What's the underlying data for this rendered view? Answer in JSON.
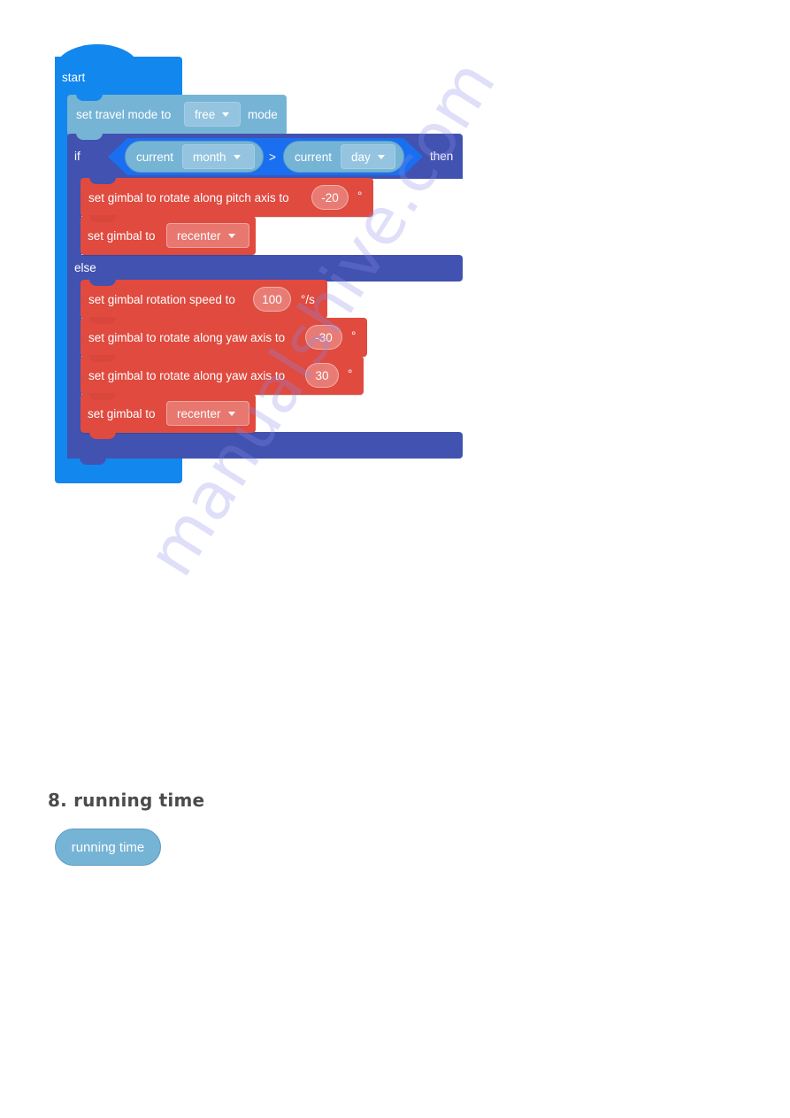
{
  "program": {
    "start": {
      "label": "start"
    },
    "travel_mode": {
      "prefix": "set travel mode to",
      "dropdown_value": "free",
      "suffix": "mode"
    },
    "if_block": {
      "if_label": "if",
      "then_label": "then",
      "else_label": "else",
      "condition": {
        "left": {
          "label": "current",
          "dropdown_value": "month"
        },
        "operator": ">",
        "right": {
          "label": "current",
          "dropdown_value": "day"
        }
      },
      "then_branch": [
        {
          "text": "set gimbal to rotate along pitch axis to",
          "value": "-20",
          "unit": "°"
        },
        {
          "text": "set gimbal to",
          "dropdown_value": "recenter"
        }
      ],
      "else_branch": [
        {
          "text": "set gimbal rotation speed to",
          "value": "100",
          "unit": "°/s"
        },
        {
          "text": "set gimbal to rotate along yaw axis to",
          "value": "-30",
          "unit": "°"
        },
        {
          "text": "set gimbal to rotate along yaw axis to",
          "value": "30",
          "unit": "°"
        },
        {
          "text": "set gimbal to",
          "dropdown_value": "recenter"
        }
      ]
    }
  },
  "section": {
    "heading": "8. running time",
    "reporter_block": "running time"
  },
  "watermark": "manualshive.com",
  "colors": {
    "event_blue": "#1287ee",
    "sensor_light_blue": "#76b4d6",
    "control_indigo": "#4152b0",
    "condition_blue": "#1a6ff0",
    "gimbal_red": "#e04a3f",
    "heading_gray": "#4b4b4b"
  }
}
